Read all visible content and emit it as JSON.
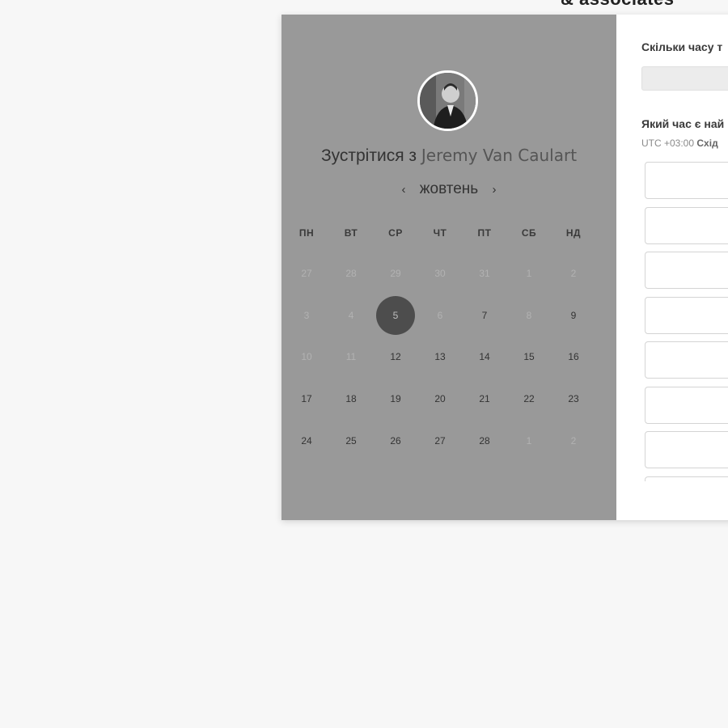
{
  "brand": {
    "text": "& associates"
  },
  "left_panel": {
    "title_prefix": "Зустрітися з",
    "title_name": "Jeremy Van Caulart",
    "month": "жовтень",
    "prev_icon": "‹",
    "next_icon": "›",
    "weekdays": [
      "ПН",
      "ВТ",
      "СР",
      "ЧТ",
      "ПТ",
      "СБ",
      "НД"
    ],
    "weeks": [
      [
        {
          "d": "27",
          "s": "muted"
        },
        {
          "d": "28",
          "s": "muted"
        },
        {
          "d": "29",
          "s": "muted"
        },
        {
          "d": "30",
          "s": "muted"
        },
        {
          "d": "31",
          "s": "muted"
        },
        {
          "d": "1",
          "s": "muted"
        },
        {
          "d": "2",
          "s": "muted"
        }
      ],
      [
        {
          "d": "3",
          "s": "muted"
        },
        {
          "d": "4",
          "s": "muted"
        },
        {
          "d": "5",
          "s": "selected"
        },
        {
          "d": "6",
          "s": "muted"
        },
        {
          "d": "7",
          "s": "active"
        },
        {
          "d": "8",
          "s": "muted"
        },
        {
          "d": "9",
          "s": "active"
        }
      ],
      [
        {
          "d": "10",
          "s": "muted"
        },
        {
          "d": "11",
          "s": "muted"
        },
        {
          "d": "12",
          "s": "active"
        },
        {
          "d": "13",
          "s": "active"
        },
        {
          "d": "14",
          "s": "active"
        },
        {
          "d": "15",
          "s": "active"
        },
        {
          "d": "16",
          "s": "active"
        }
      ],
      [
        {
          "d": "17",
          "s": "active"
        },
        {
          "d": "18",
          "s": "active"
        },
        {
          "d": "19",
          "s": "active"
        },
        {
          "d": "20",
          "s": "active"
        },
        {
          "d": "21",
          "s": "active"
        },
        {
          "d": "22",
          "s": "active"
        },
        {
          "d": "23",
          "s": "active"
        }
      ],
      [
        {
          "d": "24",
          "s": "active"
        },
        {
          "d": "25",
          "s": "active"
        },
        {
          "d": "26",
          "s": "active"
        },
        {
          "d": "27",
          "s": "active"
        },
        {
          "d": "28",
          "s": "active"
        },
        {
          "d": "1",
          "s": "muted"
        },
        {
          "d": "2",
          "s": "muted"
        }
      ]
    ]
  },
  "right_panel": {
    "question_duration": "Скільки часу т",
    "question_time": "Який час є най",
    "timezone_offset": "UTC +03:00",
    "timezone_name": "Схід",
    "slot_count": 8
  },
  "colors": {
    "left_panel_bg": "#999999",
    "selected_day_bg": "#4d4d4d",
    "page_bg": "#f7f7f7"
  }
}
